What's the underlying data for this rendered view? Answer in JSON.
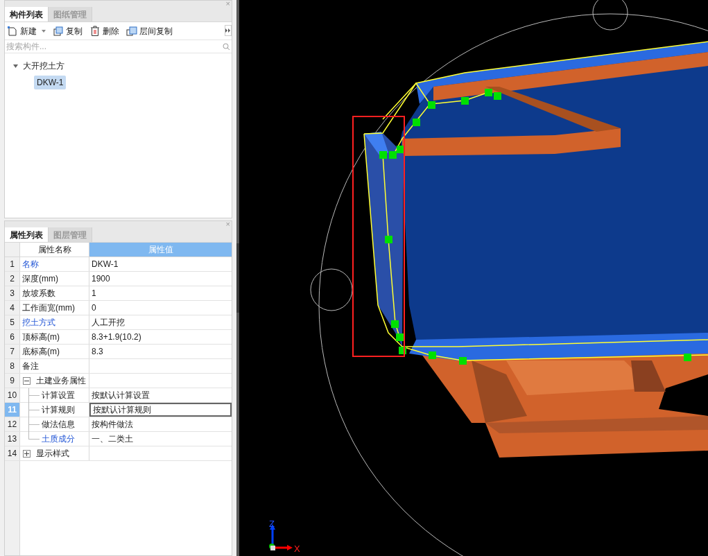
{
  "component_panel": {
    "close": "×",
    "tabs": [
      {
        "label": "构件列表",
        "selected": true
      },
      {
        "label": "图纸管理",
        "selected": false
      }
    ],
    "toolbar": [
      {
        "kind": "new",
        "label": "新建"
      },
      {
        "kind": "copy",
        "label": "复制"
      },
      {
        "kind": "delete",
        "label": "删除"
      },
      {
        "kind": "floor-copy",
        "label": "层间复制"
      }
    ],
    "search": {
      "placeholder": "搜索构件..."
    },
    "tree": [
      {
        "label": "大开挖土方",
        "expanded": true,
        "children": [
          {
            "label": "DKW-1",
            "selected": true
          }
        ]
      }
    ]
  },
  "property_panel": {
    "close": "×",
    "tabs": [
      {
        "label": "属性列表",
        "selected": true
      },
      {
        "label": "图层管理",
        "selected": false
      }
    ],
    "columns": [
      "属性名称",
      "属性值"
    ],
    "rows": [
      {
        "number": "1",
        "name": "名称",
        "value": "DKW-1",
        "kind": "link",
        "selected": false
      },
      {
        "number": "2",
        "name": "深度(mm)",
        "value": "1900",
        "kind": "plain",
        "selected": false
      },
      {
        "number": "3",
        "name": "放坡系数",
        "value": "1",
        "kind": "plain",
        "selected": false
      },
      {
        "number": "4",
        "name": "工作面宽(mm)",
        "value": "0",
        "kind": "plain",
        "selected": false
      },
      {
        "number": "5",
        "name": "挖土方式",
        "value": "人工开挖",
        "kind": "link",
        "selected": false
      },
      {
        "number": "6",
        "name": "顶标高(m)",
        "value": "8.3+1.9(10.2)",
        "kind": "plain",
        "selected": false
      },
      {
        "number": "7",
        "name": "底标高(m)",
        "value": "8.3",
        "kind": "plain",
        "selected": false
      },
      {
        "number": "8",
        "name": "备注",
        "kind": "plain",
        "selected": false
      },
      {
        "number": "9",
        "name": "土建业务属性",
        "kind": "plain",
        "selected": false,
        "expanded": true,
        "children": [
          {
            "number": "10",
            "name": "计算设置",
            "value": "按默认计算设置",
            "kind": "plain",
            "selected": false
          },
          {
            "number": "11",
            "name": "计算规则",
            "value": "按默认计算规则",
            "kind": "plain",
            "selected": true
          },
          {
            "number": "12",
            "name": "做法信息",
            "value": "按构件做法",
            "kind": "plain",
            "selected": false
          },
          {
            "number": "13",
            "name": "土质成分",
            "value": "一、二类土",
            "kind": "link",
            "selected": false
          }
        ]
      },
      {
        "number": "14",
        "name": "显示样式",
        "kind": "plain",
        "selected": false,
        "expanded": false
      }
    ]
  },
  "viewport": {
    "axis_labels": {
      "z": "Z",
      "x": "X"
    }
  }
}
